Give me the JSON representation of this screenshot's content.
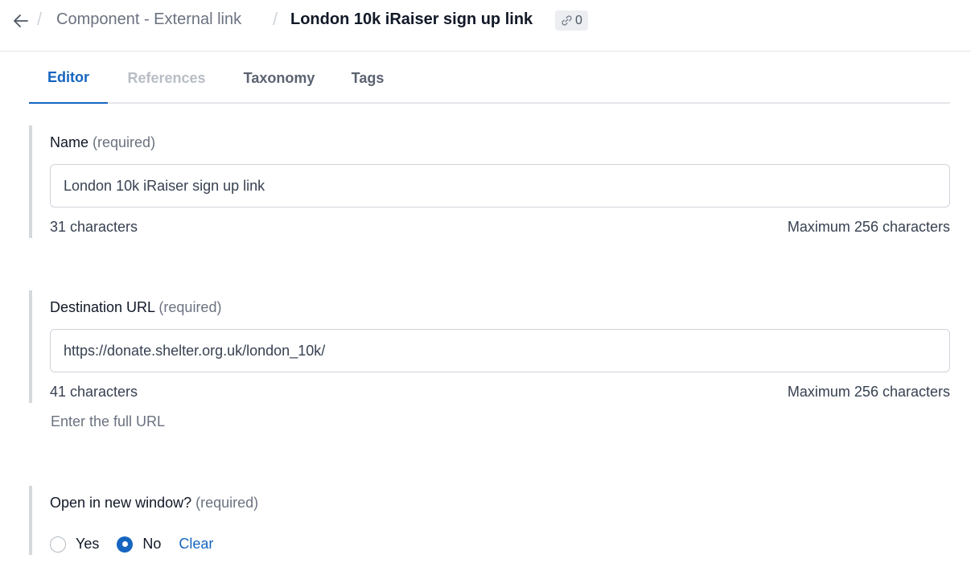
{
  "header": {
    "back_icon": "arrow-left-icon",
    "breadcrumb": "Component - External link",
    "separator": "/",
    "title": "London 10k iRaiser sign up link",
    "link_icon": "link-icon",
    "reference_count": "0"
  },
  "tabs": [
    {
      "label": "Editor",
      "state": "active"
    },
    {
      "label": "References",
      "state": "disabled"
    },
    {
      "label": "Taxonomy",
      "state": "normal"
    },
    {
      "label": "Tags",
      "state": "normal"
    }
  ],
  "fields": {
    "name": {
      "label": "Name",
      "required": "(required)",
      "value": "London 10k iRaiser sign up link",
      "count": "31 characters",
      "max": "Maximum 256 characters"
    },
    "url": {
      "label": "Destination URL",
      "required": "(required)",
      "value": "https://donate.shelter.org.uk/london_10k/",
      "count": "41 characters",
      "max": "Maximum 256 characters",
      "help": "Enter the full URL"
    },
    "new_window": {
      "label": "Open in new window?",
      "required": "(required)",
      "options": [
        "Yes",
        "No"
      ],
      "selected": "No",
      "clear": "Clear"
    }
  },
  "colors": {
    "accent": "#1565c0",
    "muted": "#6b7280",
    "border": "#cfd4da"
  }
}
